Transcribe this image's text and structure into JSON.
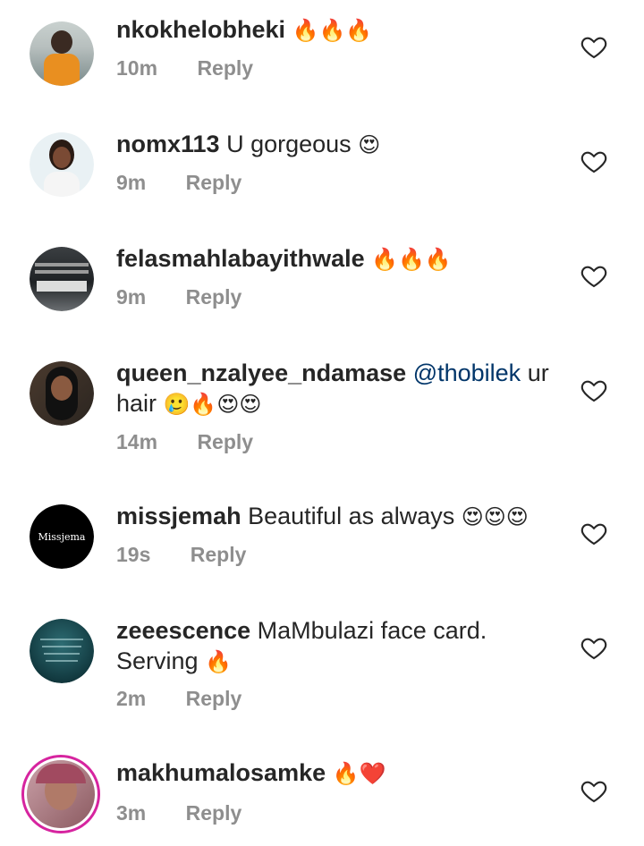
{
  "comments": [
    {
      "username": "nkokhelobheki",
      "mention": "",
      "text": "",
      "emoji": "🔥🔥🔥",
      "time": "10m",
      "reply": "Reply"
    },
    {
      "username": "nomx113",
      "mention": "",
      "text": "U gorgeous",
      "emoji": "😍",
      "time": "9m",
      "reply": "Reply"
    },
    {
      "username": "felasmahlabayithwale",
      "mention": "",
      "text": "",
      "emoji": "🔥🔥🔥",
      "time": "9m",
      "reply": "Reply"
    },
    {
      "username": "queen_nzalyee_ndamase",
      "mention": "@thobilek",
      "text": "ur hair",
      "emoji": "🥲🔥😍😍",
      "time": "14m",
      "reply": "Reply"
    },
    {
      "username": "missjemah",
      "mention": "",
      "text": "Beautiful as always",
      "emoji": "😍😍😍",
      "time": "19s",
      "reply": "Reply",
      "avatar_text": "Missjema"
    },
    {
      "username": "zeeescence",
      "mention": "",
      "text": "MaMbulazi face card. Serving",
      "emoji": "🔥",
      "time": "2m",
      "reply": "Reply"
    },
    {
      "username": "makhumalosamke",
      "mention": "",
      "text": "",
      "emoji": "🔥❤️",
      "time": "3m",
      "reply": "Reply"
    }
  ],
  "icons": {
    "like": "heart-outline-icon"
  },
  "colors": {
    "username": "#262626",
    "meta": "#8e8e8e",
    "mention": "#003569",
    "story_ring": "#d6249f"
  }
}
